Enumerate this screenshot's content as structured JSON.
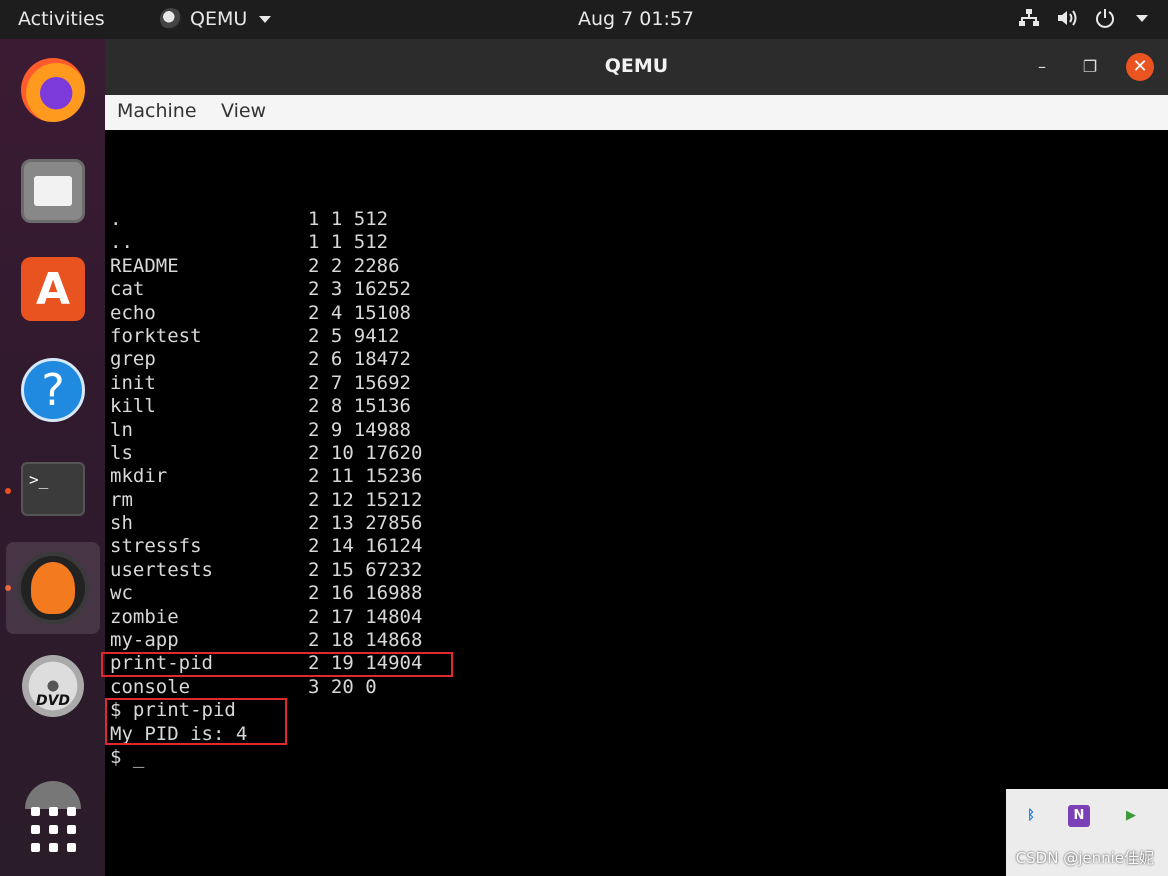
{
  "topbar": {
    "activities": "Activities",
    "app_name": "QEMU",
    "clock": "Aug 7  01:57"
  },
  "window": {
    "title": "QEMU",
    "minimize": "–",
    "maximize": "❐",
    "close": "✕"
  },
  "menubar": {
    "items": [
      "Machine",
      "View"
    ]
  },
  "dock": {
    "store_glyph": "A",
    "help_glyph": "?",
    "terminal_glyph": ">_",
    "dvd_label": "DVD"
  },
  "console": {
    "listing": [
      {
        "name": ".",
        "info": "1 1 512"
      },
      {
        "name": "..",
        "info": "1 1 512"
      },
      {
        "name": "README",
        "info": "2 2 2286"
      },
      {
        "name": "cat",
        "info": "2 3 16252"
      },
      {
        "name": "echo",
        "info": "2 4 15108"
      },
      {
        "name": "forktest",
        "info": "2 5 9412"
      },
      {
        "name": "grep",
        "info": "2 6 18472"
      },
      {
        "name": "init",
        "info": "2 7 15692"
      },
      {
        "name": "kill",
        "info": "2 8 15136"
      },
      {
        "name": "ln",
        "info": "2 9 14988"
      },
      {
        "name": "ls",
        "info": "2 10 17620"
      },
      {
        "name": "mkdir",
        "info": "2 11 15236"
      },
      {
        "name": "rm",
        "info": "2 12 15212"
      },
      {
        "name": "sh",
        "info": "2 13 27856"
      },
      {
        "name": "stressfs",
        "info": "2 14 16124"
      },
      {
        "name": "usertests",
        "info": "2 15 67232"
      },
      {
        "name": "wc",
        "info": "2 16 16988"
      },
      {
        "name": "zombie",
        "info": "2 17 14804"
      },
      {
        "name": "my-app",
        "info": "2 18 14868"
      },
      {
        "name": "print-pid",
        "info": "2 19 14904"
      },
      {
        "name": "console",
        "info": "3 20 0"
      }
    ],
    "command": "$ print-pid",
    "output": "My PID is: 4",
    "prompt": "$ _"
  },
  "watermark": "CSDN @jennie佳妮",
  "colors": {
    "highlight": "#e0282d",
    "accent": "#e95420"
  }
}
